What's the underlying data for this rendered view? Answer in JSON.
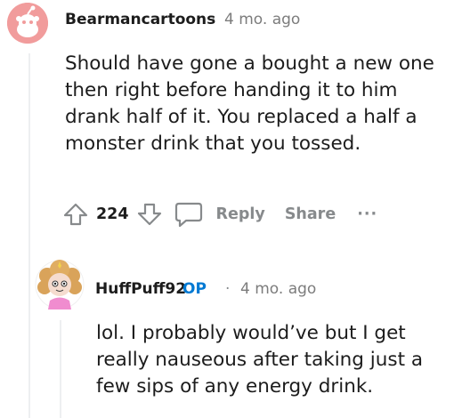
{
  "comment1": {
    "author": "Bearmancartoons",
    "separator": "·",
    "time": "4 mo. ago",
    "body": "Should have gone a bought a new one then right before handing it to him drank half of it. You replaced a half a monster drink that you tossed.",
    "score": "224",
    "actions": {
      "reply": "Reply",
      "share": "Share",
      "more": "···"
    }
  },
  "comment2": {
    "author": "HuffPuff92",
    "badge": "OP",
    "separator": "·",
    "time": "4 mo. ago",
    "body": "lol. I probably would’ve but I get really nauseous after taking just a few sips of any energy drink."
  },
  "colors": {
    "avatar1_bg": "#f19c9c",
    "op_badge": "#0079d3",
    "meta_gray": "#878a8c"
  },
  "icons": {
    "upvote": "arrow-up-outline",
    "downvote": "arrow-down-outline",
    "comment": "speech-bubble-outline",
    "avatar1": "reddit-snoo-default",
    "avatar2": "curly-hair-character"
  }
}
